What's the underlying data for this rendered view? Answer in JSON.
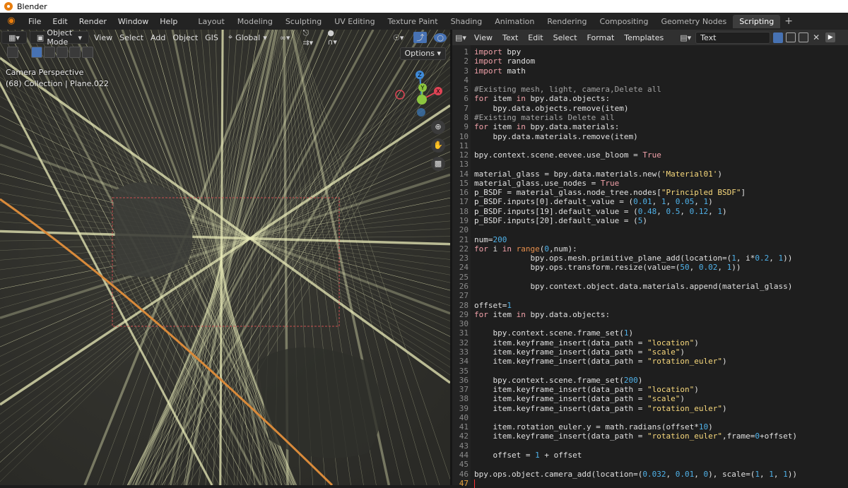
{
  "window": {
    "title": "Blender"
  },
  "menu": {
    "items": [
      "File",
      "Edit",
      "Render",
      "Window",
      "Help"
    ]
  },
  "workspaces": {
    "tabs": [
      "Layout",
      "Modeling",
      "Sculpting",
      "UV Editing",
      "Texture Paint",
      "Shading",
      "Animation",
      "Rendering",
      "Compositing",
      "Geometry Nodes",
      "Scripting"
    ],
    "active": "Scripting",
    "add_label": "+"
  },
  "viewport": {
    "mode": "Object Mode",
    "menus": [
      "View",
      "Select",
      "Add",
      "Object",
      "GIS"
    ],
    "orientation": "Global",
    "options_label": "Options",
    "info_line1": "Camera Perspective",
    "info_line2": "(68) Collection | Plane.022",
    "gizmo_axes": {
      "x": "X",
      "y": "Y",
      "z": "Z"
    },
    "colors": {
      "background": "#2f2f2b",
      "lines": "#e9ebb8",
      "orange_edge": "#d98a3a",
      "axis_x": "#e04455",
      "axis_y": "#8cc63f",
      "axis_z": "#3f8bd9"
    }
  },
  "text_editor": {
    "menus": [
      "View",
      "Text",
      "Edit",
      "Select",
      "Format",
      "Templates"
    ],
    "datablock_name": "Text",
    "current_line": 47,
    "lines": [
      "import bpy",
      "import random",
      "import math",
      "",
      "#Existing mesh, light, camera,Delete all",
      "for item in bpy.data.objects:",
      "    bpy.data.objects.remove(item)",
      "#Existing materials Delete all",
      "for item in bpy.data.materials:",
      "    bpy.data.materials.remove(item)",
      "",
      "bpy.context.scene.eevee.use_bloom = True",
      "",
      "material_glass = bpy.data.materials.new('Material01')",
      "material_glass.use_nodes = True",
      "p_BSDF = material_glass.node_tree.nodes[\"Principled BSDF\"]",
      "p_BSDF.inputs[0].default_value = (0.01, 1, 0.05, 1)",
      "p_BSDF.inputs[19].default_value = (0.48, 0.5, 0.12, 1)",
      "p_BSDF.inputs[20].default_value = (5)",
      "",
      "num=200",
      "for i in range(0,num):",
      "            bpy.ops.mesh.primitive_plane_add(location=(1, i*0.2, 1))",
      "            bpy.ops.transform.resize(value=(50, 0.02, 1))",
      "",
      "            bpy.context.object.data.materials.append(material_glass)",
      "",
      "offset=1",
      "for item in bpy.data.objects:",
      "",
      "    bpy.context.scene.frame_set(1)",
      "    item.keyframe_insert(data_path = \"location\")",
      "    item.keyframe_insert(data_path = \"scale\")",
      "    item.keyframe_insert(data_path = \"rotation_euler\")",
      "",
      "    bpy.context.scene.frame_set(200)",
      "    item.keyframe_insert(data_path = \"location\")",
      "    item.keyframe_insert(data_path = \"scale\")",
      "    item.keyframe_insert(data_path = \"rotation_euler\")",
      "",
      "    item.rotation_euler.y = math.radians(offset*10)",
      "    item.keyframe_insert(data_path = \"rotation_euler\",frame=0+offset)",
      "",
      "    offset = 1 + offset",
      "",
      "bpy.ops.object.camera_add(location=(0.032, 0.01, 0), scale=(1, 1, 1))",
      ""
    ]
  }
}
